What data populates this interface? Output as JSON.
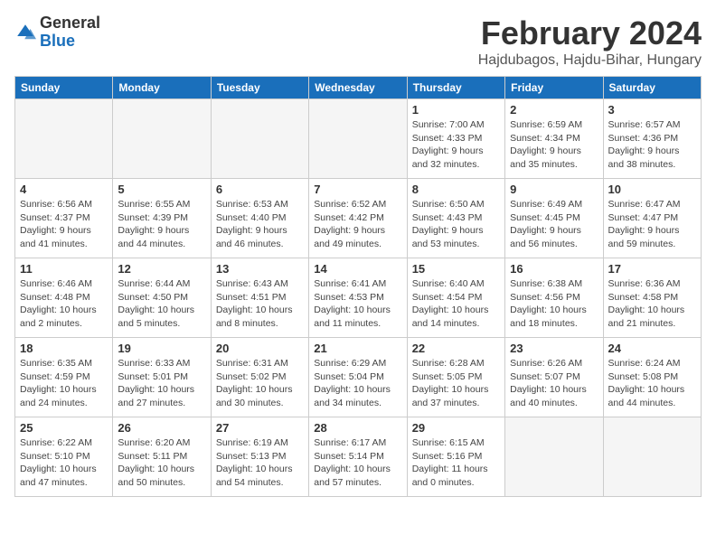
{
  "logo": {
    "general": "General",
    "blue": "Blue"
  },
  "header": {
    "month": "February 2024",
    "location": "Hajdubagos, Hajdu-Bihar, Hungary"
  },
  "weekdays": [
    "Sunday",
    "Monday",
    "Tuesday",
    "Wednesday",
    "Thursday",
    "Friday",
    "Saturday"
  ],
  "weeks": [
    [
      {
        "day": "",
        "info": ""
      },
      {
        "day": "",
        "info": ""
      },
      {
        "day": "",
        "info": ""
      },
      {
        "day": "",
        "info": ""
      },
      {
        "day": "1",
        "info": "Sunrise: 7:00 AM\nSunset: 4:33 PM\nDaylight: 9 hours\nand 32 minutes."
      },
      {
        "day": "2",
        "info": "Sunrise: 6:59 AM\nSunset: 4:34 PM\nDaylight: 9 hours\nand 35 minutes."
      },
      {
        "day": "3",
        "info": "Sunrise: 6:57 AM\nSunset: 4:36 PM\nDaylight: 9 hours\nand 38 minutes."
      }
    ],
    [
      {
        "day": "4",
        "info": "Sunrise: 6:56 AM\nSunset: 4:37 PM\nDaylight: 9 hours\nand 41 minutes."
      },
      {
        "day": "5",
        "info": "Sunrise: 6:55 AM\nSunset: 4:39 PM\nDaylight: 9 hours\nand 44 minutes."
      },
      {
        "day": "6",
        "info": "Sunrise: 6:53 AM\nSunset: 4:40 PM\nDaylight: 9 hours\nand 46 minutes."
      },
      {
        "day": "7",
        "info": "Sunrise: 6:52 AM\nSunset: 4:42 PM\nDaylight: 9 hours\nand 49 minutes."
      },
      {
        "day": "8",
        "info": "Sunrise: 6:50 AM\nSunset: 4:43 PM\nDaylight: 9 hours\nand 53 minutes."
      },
      {
        "day": "9",
        "info": "Sunrise: 6:49 AM\nSunset: 4:45 PM\nDaylight: 9 hours\nand 56 minutes."
      },
      {
        "day": "10",
        "info": "Sunrise: 6:47 AM\nSunset: 4:47 PM\nDaylight: 9 hours\nand 59 minutes."
      }
    ],
    [
      {
        "day": "11",
        "info": "Sunrise: 6:46 AM\nSunset: 4:48 PM\nDaylight: 10 hours\nand 2 minutes."
      },
      {
        "day": "12",
        "info": "Sunrise: 6:44 AM\nSunset: 4:50 PM\nDaylight: 10 hours\nand 5 minutes."
      },
      {
        "day": "13",
        "info": "Sunrise: 6:43 AM\nSunset: 4:51 PM\nDaylight: 10 hours\nand 8 minutes."
      },
      {
        "day": "14",
        "info": "Sunrise: 6:41 AM\nSunset: 4:53 PM\nDaylight: 10 hours\nand 11 minutes."
      },
      {
        "day": "15",
        "info": "Sunrise: 6:40 AM\nSunset: 4:54 PM\nDaylight: 10 hours\nand 14 minutes."
      },
      {
        "day": "16",
        "info": "Sunrise: 6:38 AM\nSunset: 4:56 PM\nDaylight: 10 hours\nand 18 minutes."
      },
      {
        "day": "17",
        "info": "Sunrise: 6:36 AM\nSunset: 4:58 PM\nDaylight: 10 hours\nand 21 minutes."
      }
    ],
    [
      {
        "day": "18",
        "info": "Sunrise: 6:35 AM\nSunset: 4:59 PM\nDaylight: 10 hours\nand 24 minutes."
      },
      {
        "day": "19",
        "info": "Sunrise: 6:33 AM\nSunset: 5:01 PM\nDaylight: 10 hours\nand 27 minutes."
      },
      {
        "day": "20",
        "info": "Sunrise: 6:31 AM\nSunset: 5:02 PM\nDaylight: 10 hours\nand 30 minutes."
      },
      {
        "day": "21",
        "info": "Sunrise: 6:29 AM\nSunset: 5:04 PM\nDaylight: 10 hours\nand 34 minutes."
      },
      {
        "day": "22",
        "info": "Sunrise: 6:28 AM\nSunset: 5:05 PM\nDaylight: 10 hours\nand 37 minutes."
      },
      {
        "day": "23",
        "info": "Sunrise: 6:26 AM\nSunset: 5:07 PM\nDaylight: 10 hours\nand 40 minutes."
      },
      {
        "day": "24",
        "info": "Sunrise: 6:24 AM\nSunset: 5:08 PM\nDaylight: 10 hours\nand 44 minutes."
      }
    ],
    [
      {
        "day": "25",
        "info": "Sunrise: 6:22 AM\nSunset: 5:10 PM\nDaylight: 10 hours\nand 47 minutes."
      },
      {
        "day": "26",
        "info": "Sunrise: 6:20 AM\nSunset: 5:11 PM\nDaylight: 10 hours\nand 50 minutes."
      },
      {
        "day": "27",
        "info": "Sunrise: 6:19 AM\nSunset: 5:13 PM\nDaylight: 10 hours\nand 54 minutes."
      },
      {
        "day": "28",
        "info": "Sunrise: 6:17 AM\nSunset: 5:14 PM\nDaylight: 10 hours\nand 57 minutes."
      },
      {
        "day": "29",
        "info": "Sunrise: 6:15 AM\nSunset: 5:16 PM\nDaylight: 11 hours\nand 0 minutes."
      },
      {
        "day": "",
        "info": ""
      },
      {
        "day": "",
        "info": ""
      }
    ]
  ]
}
